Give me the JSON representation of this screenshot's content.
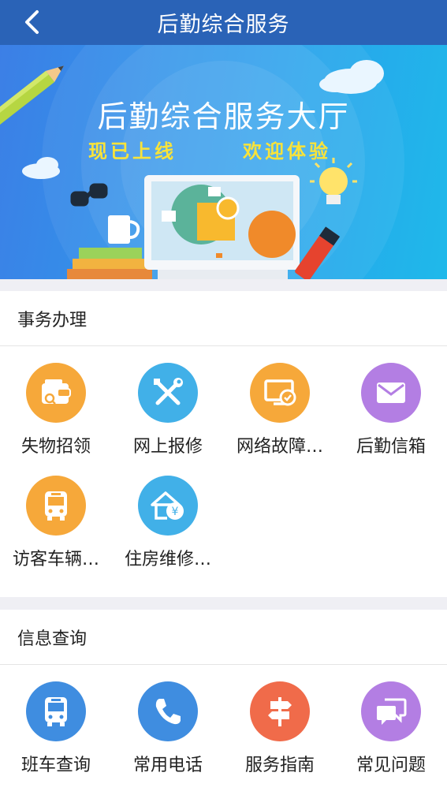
{
  "nav": {
    "title": "后勤综合服务",
    "back_icon": "chevron-left-icon"
  },
  "banner": {
    "title": "后勤综合服务大厅",
    "subtitle_left": "现已上线",
    "subtitle_right": "欢迎体验"
  },
  "colors": {
    "nav": "#2a63b7",
    "orange": "#f6a83a",
    "blue": "#41b0e8",
    "purple": "#b37ee3",
    "red": "#f06b4a",
    "phone_blue": "#3f8de0"
  },
  "affairs": {
    "heading": "事务办理",
    "items": [
      {
        "label": "失物招领",
        "icon": "wallet-search-icon",
        "color": "#f6a83a"
      },
      {
        "label": "网上报修",
        "icon": "tools-icon",
        "color": "#41b0e8"
      },
      {
        "label": "网络故障…",
        "icon": "monitor-check-icon",
        "color": "#f6a83a"
      },
      {
        "label": "后勤信箱",
        "icon": "envelope-icon",
        "color": "#b37ee3"
      },
      {
        "label": "访客车辆…",
        "icon": "bus-icon",
        "color": "#f6a83a"
      },
      {
        "label": "住房维修…",
        "icon": "house-yen-icon",
        "color": "#41b0e8"
      }
    ]
  },
  "info": {
    "heading": "信息查询",
    "items": [
      {
        "label": "班车查询",
        "icon": "bus-icon",
        "color": "#3f8de0"
      },
      {
        "label": "常用电话",
        "icon": "phone-icon",
        "color": "#3f8de0"
      },
      {
        "label": "服务指南",
        "icon": "signpost-icon",
        "color": "#f06b4a"
      },
      {
        "label": "常见问题",
        "icon": "chat-bubbles-icon",
        "color": "#b37ee3"
      }
    ]
  }
}
